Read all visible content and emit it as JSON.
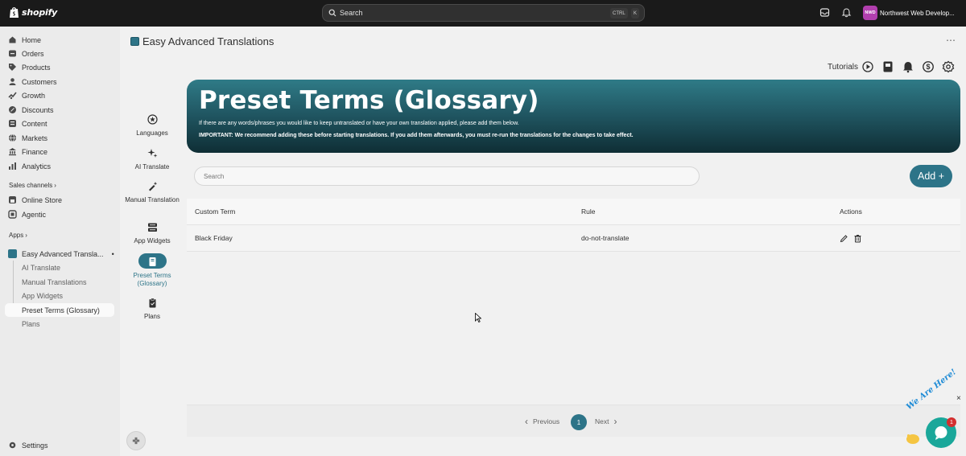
{
  "topbar": {
    "logo_text": "shopify",
    "search_placeholder": "Search",
    "shortcut_ctrl": "CTRL",
    "shortcut_k": "K",
    "store_avatar": "NWD",
    "store_name": "Northwest Web Develop..."
  },
  "sidebar": {
    "items": [
      {
        "label": "Home",
        "icon": "home-icon"
      },
      {
        "label": "Orders",
        "icon": "inbox-icon"
      },
      {
        "label": "Products",
        "icon": "tag-icon"
      },
      {
        "label": "Customers",
        "icon": "person-icon"
      },
      {
        "label": "Growth",
        "icon": "growth-icon"
      },
      {
        "label": "Discounts",
        "icon": "discount-icon"
      },
      {
        "label": "Content",
        "icon": "content-icon"
      },
      {
        "label": "Markets",
        "icon": "globe-icon"
      },
      {
        "label": "Finance",
        "icon": "bank-icon"
      },
      {
        "label": "Analytics",
        "icon": "bar-chart-icon"
      }
    ],
    "sales_channels_label": "Sales channels",
    "channels": [
      {
        "label": "Online Store"
      },
      {
        "label": "Agentic"
      }
    ],
    "apps_label": "Apps",
    "app_name": "Easy Advanced Transla...",
    "app_subitems": [
      "AI Translate",
      "Manual Translations",
      "App Widgets",
      "Preset Terms (Glossary)",
      "Plans"
    ],
    "settings_label": "Settings"
  },
  "page": {
    "title": "Easy Advanced Translations",
    "more": "⋯",
    "tutorials_label": "Tutorials"
  },
  "app_nav": [
    {
      "label": "Languages"
    },
    {
      "label": "AI Translate"
    },
    {
      "label": "Manual Translation"
    },
    {
      "label": "App Widgets"
    },
    {
      "label": "Preset Terms (Glossary)"
    },
    {
      "label": "Plans"
    }
  ],
  "banner": {
    "title": "Preset Terms (Glossary)",
    "description": "If there are any words/phrases you would like to keep untranslated or have your own translation applied, please add them below.",
    "important": "IMPORTANT: We recommend adding these before starting translations. If you add them afterwards, you must re-run the translations for the changes to take effect."
  },
  "search": {
    "placeholder": "Search"
  },
  "add_button": "Add +",
  "table": {
    "headers": {
      "term": "Custom Term",
      "rule": "Rule",
      "actions": "Actions"
    },
    "rows": [
      {
        "term": "Black Friday",
        "rule": "do-not-translate"
      }
    ]
  },
  "pagination": {
    "previous": "Previous",
    "current": "1",
    "next": "Next"
  },
  "chat": {
    "tagline": "We Are Here!",
    "unread": "1",
    "close": "×"
  },
  "colors": {
    "accent": "#2d7488",
    "topbar": "#1a1a1a",
    "chat": "#1aa79a"
  }
}
